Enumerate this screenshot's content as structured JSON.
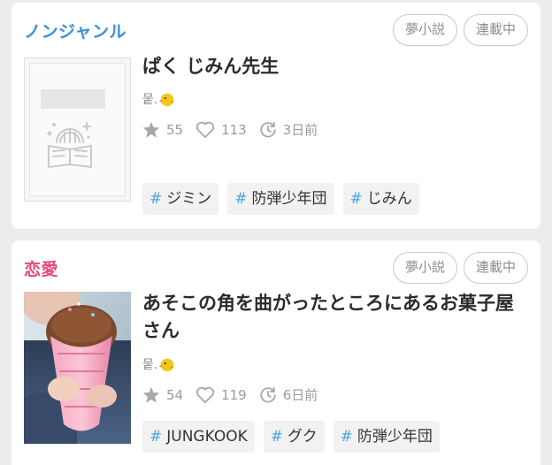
{
  "cards": [
    {
      "genre": "ノンジャンル",
      "genre_color": "#3b8fd6",
      "badges": [
        "夢小説",
        "連載中"
      ],
      "cover": "placeholder-book-cover",
      "title": "ぱく じみん先生",
      "author": "뭍.",
      "author_icon": "chick-emoji",
      "stats": {
        "stars": "55",
        "likes": "113",
        "updated": "3日前"
      },
      "tags": [
        "ジミン",
        "防弾少年団",
        "じみん"
      ]
    },
    {
      "genre": "恋愛",
      "genre_color": "#e8477a",
      "badges": [
        "夢小説",
        "連載中"
      ],
      "cover": "photo-cover",
      "title": "あそこの角を曲がったところにあるお菓子屋さん",
      "author": "뭍.",
      "author_icon": "chick-emoji",
      "stats": {
        "stars": "54",
        "likes": "119",
        "updated": "6日前"
      },
      "tags": [
        "JUNGKOOK",
        "グク",
        "防弾少年団"
      ]
    }
  ],
  "icons": {
    "star": "star-icon",
    "heart": "heart-icon",
    "clock": "clock-icon",
    "hash": "#"
  }
}
